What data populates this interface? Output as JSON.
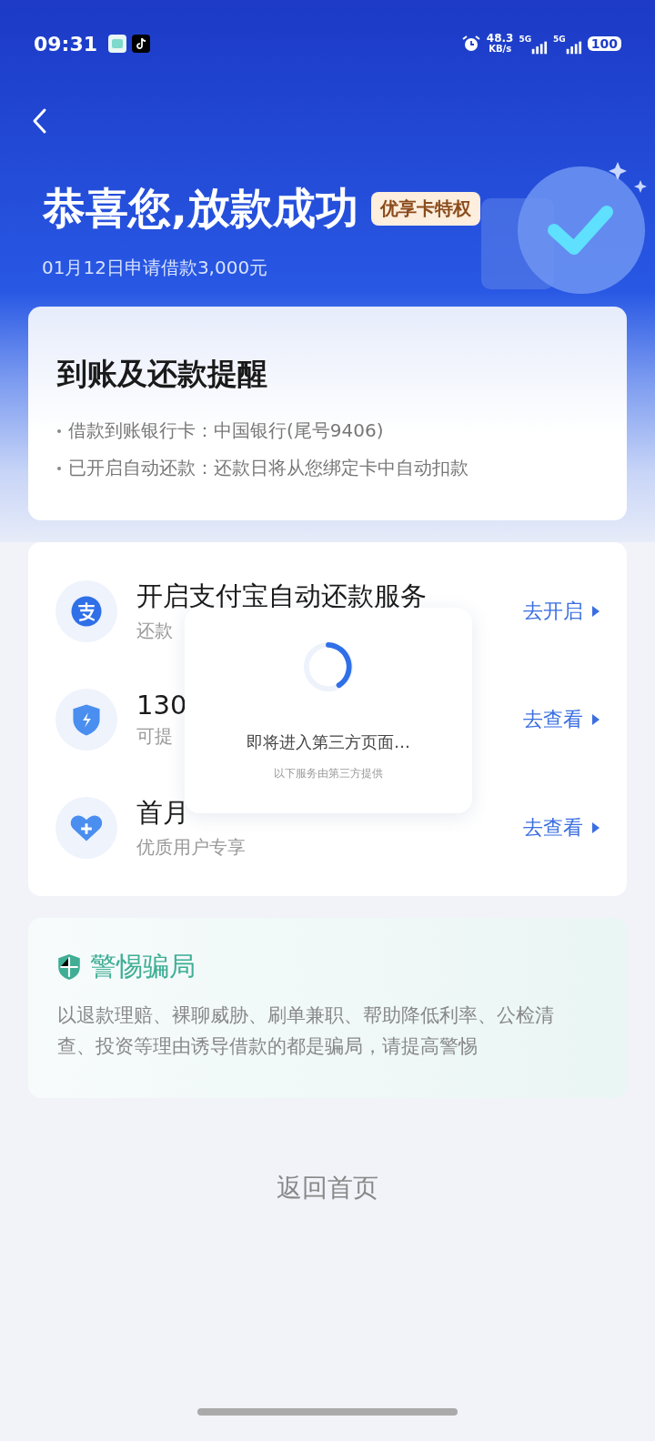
{
  "status_bar": {
    "time": "09:31",
    "net_speed": "48.3",
    "net_unit": "KB/s",
    "signals": [
      "5G",
      "5G"
    ],
    "battery": "100"
  },
  "header": {
    "title": "恭喜您,放款成功",
    "badge": "优享卡特权",
    "subtitle": "01月12日申请借款3,000元"
  },
  "reminder": {
    "title": "到账及还款提醒",
    "bullets": [
      "借款到账银行卡：中国银行(尾号9406)",
      "已开启自动还款：还款日将从您绑定卡中自动扣款"
    ]
  },
  "services": [
    {
      "kind": "alipay",
      "title": "开启支付宝自动还款服务",
      "subtitle": "还款",
      "action": "去开启"
    },
    {
      "kind": "shield",
      "title": "130",
      "subtitle": "可提",
      "action": "去查看"
    },
    {
      "kind": "heart",
      "title": "首月",
      "subtitle": "优质用户专享",
      "action": "去查看"
    }
  ],
  "dialog": {
    "text": "即将进入第三方页面…",
    "note": "以下服务由第三方提供"
  },
  "warning": {
    "title": "警惕骗局",
    "body": "以退款理赔、裸聊威胁、刷单兼职、帮助降低利率、公检清查、投资等理由诱导借款的都是骗局，请提高警惕"
  },
  "back_home": "返回首页"
}
